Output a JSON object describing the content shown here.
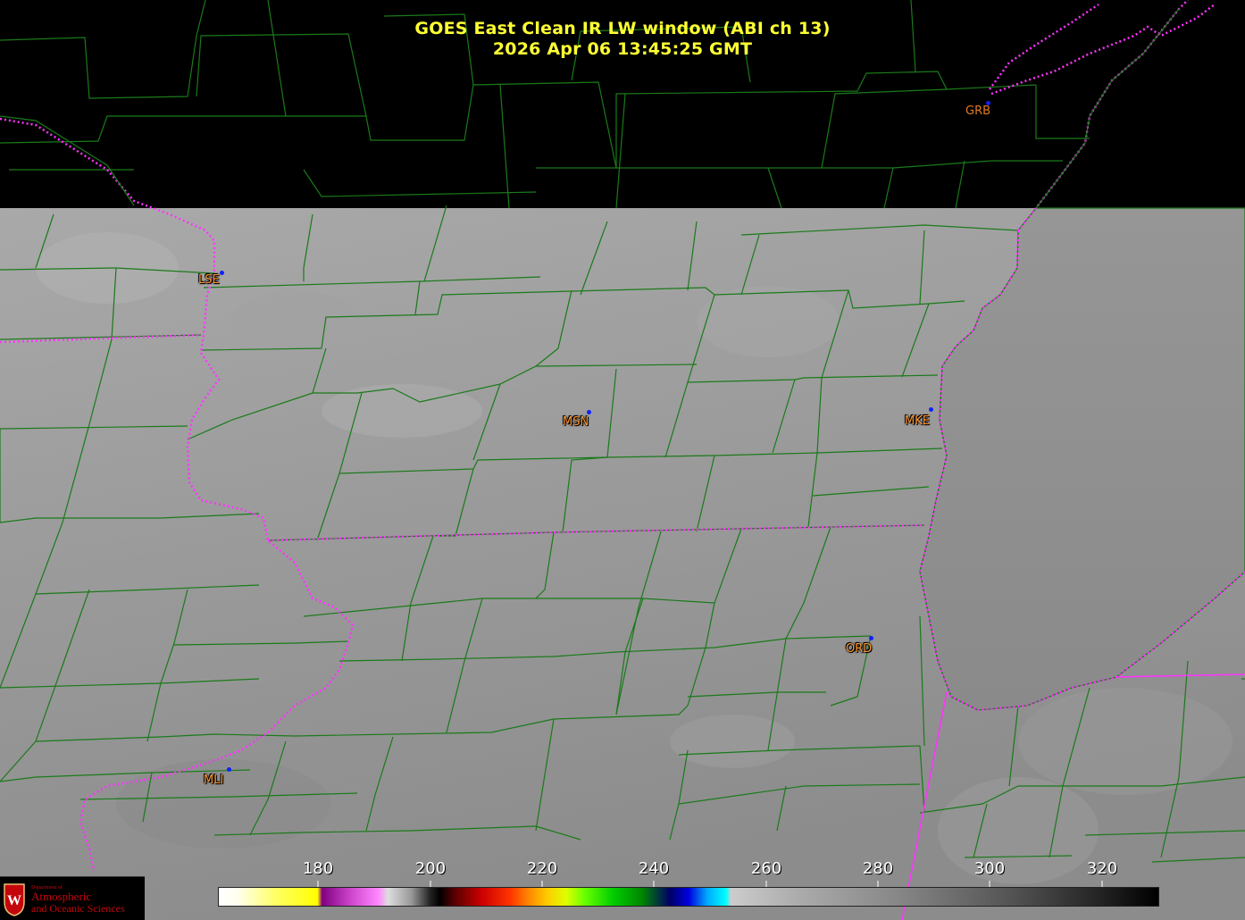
{
  "title": {
    "line1": "GOES East Clean IR LW window (ABI ch 13)",
    "line2": "2026 Apr 06  13:45:25 GMT"
  },
  "stations": [
    {
      "code": "GRB"
    },
    {
      "code": "LSE"
    },
    {
      "code": "MSN"
    },
    {
      "code": "MKE"
    },
    {
      "code": "ORD"
    },
    {
      "code": "MLI"
    }
  ],
  "colorbar": {
    "unit_range": [
      160,
      330
    ],
    "ticks": [
      "180",
      "200",
      "220",
      "240",
      "260",
      "280",
      "300",
      "320"
    ],
    "tick_values": [
      180,
      200,
      220,
      240,
      260,
      280,
      300,
      320
    ]
  },
  "logo": {
    "line1": "Department of",
    "line2": "Atmospheric",
    "line3": "and Oceanic Sciences"
  },
  "colors": {
    "title": "#ffff33",
    "station_label": "#ff9933",
    "station_dot": "#1020ff",
    "county_lines": "#1a7a1a",
    "state_borders": "#ff33ff",
    "logo": "#c5050c"
  }
}
